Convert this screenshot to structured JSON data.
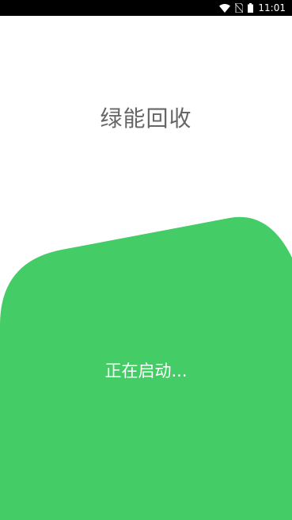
{
  "status_bar": {
    "time": "11:01",
    "icons": [
      "wifi-icon",
      "no-sim-icon",
      "battery-icon"
    ]
  },
  "app": {
    "title": "绿能回收",
    "loading_text": "正在启动..."
  },
  "colors": {
    "accent_green": "#44CC66",
    "title_gray": "#666666",
    "status_bar_bg": "#000000",
    "background": "#FFFFFF"
  }
}
